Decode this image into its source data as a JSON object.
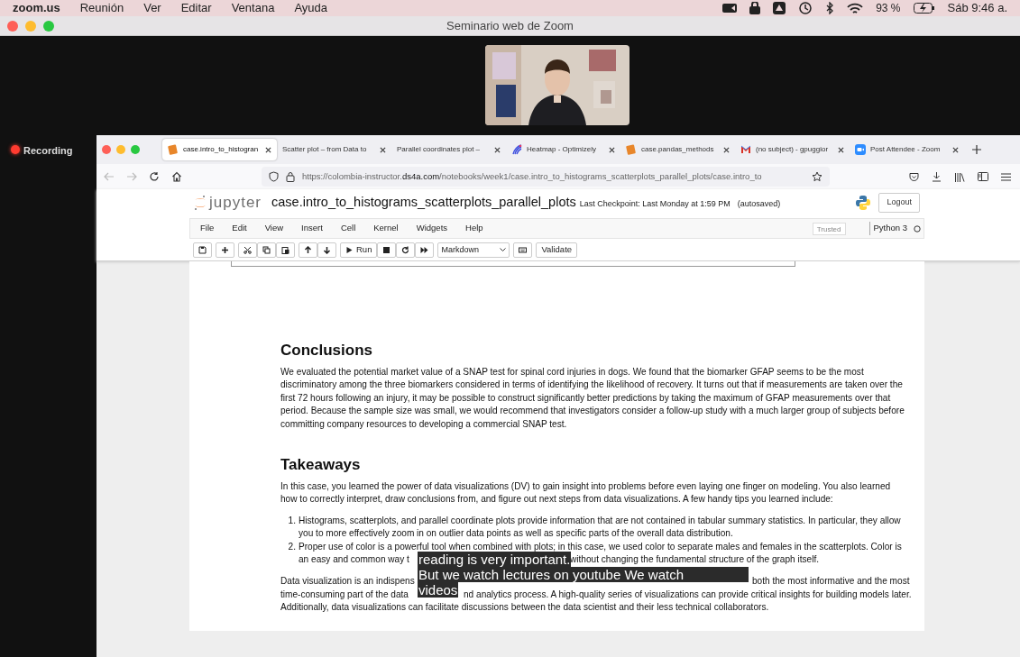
{
  "menubar": {
    "app": "zoom.us",
    "items": [
      "Reunión",
      "Ver",
      "Editar",
      "Ventana",
      "Ayuda"
    ],
    "battery": "93 %",
    "clock": "Sáb 9:46 a."
  },
  "window": {
    "title": "Seminario web de Zoom"
  },
  "recording": {
    "label": "Recording",
    "on": true
  },
  "browser": {
    "tabs": [
      {
        "title": "case.intro_to_histogran",
        "selected": true
      },
      {
        "title": "Scatter plot – from Data to",
        "selected": false
      },
      {
        "title": "Parallel coordinates plot – ",
        "selected": false
      },
      {
        "title": "Heatmap - Optimizely",
        "selected": false
      },
      {
        "title": "case.pandas_methods",
        "selected": false
      },
      {
        "title": "(no subject) - gpuggior",
        "selected": false
      },
      {
        "title": "Post Attendee - Zoom",
        "selected": false
      }
    ],
    "url": {
      "prefix": "https://colombia-instructor.",
      "domain": "ds4a.com",
      "path": "/notebooks/week1/case.intro_to_histograms_scatterplots_parallel_plots/case.intro_to"
    }
  },
  "jupyter": {
    "logo_text": "jupyter",
    "notebook_title": "case.intro_to_histograms_scatterplots_parallel_plots",
    "checkpoint": "Last Checkpoint: Last Monday at 1:59 PM",
    "save_status": "(autosaved)",
    "logout": "Logout",
    "menu": [
      "File",
      "Edit",
      "View",
      "Insert",
      "Cell",
      "Kernel",
      "Widgets",
      "Help"
    ],
    "trusted": "Trusted",
    "kernel": "Python 3",
    "toolbar": {
      "run": "Run",
      "cell_type": "Markdown",
      "validate": "Validate"
    }
  },
  "notebook": {
    "sections": [
      {
        "heading": "Conclusions",
        "blocks": [
          {
            "kind": "paragraph",
            "text": "We evaluated the potential market value of a SNAP test for spinal cord injuries in dogs. We found that the biomarker GFAP seems to be the most discriminatory among the three biomarkers considered in terms of identifying the likelihood of recovery. It turns out that if measurements are taken over the first 72 hours following an injury, it may be possible to construct significantly better predictions by taking the maximum of GFAP measurements over that period. Because the sample size was small, we would recommend that investigators consider a follow-up study with a much larger group of subjects before committing company resources to developing a commercial SNAP test."
          }
        ]
      },
      {
        "heading": "Takeaways",
        "blocks": [
          {
            "kind": "paragraph",
            "text": "In this case, you learned the power of data visualizations (DV) to gain insight into problems before even laying one finger on modeling. You also learned how to correctly interpret, draw conclusions from, and figure out next steps from data visualizations. A few handy tips you learned include:"
          },
          {
            "kind": "list",
            "items": [
              {
                "number": "1.",
                "lines": [
                  [
                    "Histograms, scatterplots, and parallel coordinate plots provide information that are not contained in tabular summary statistics. In particular, they allow"
                  ],
                  [
                    "you to more effectively zoom in on outlier data points as well as specific parts of the overall data distribution."
                  ]
                ]
              },
              {
                "number": "2.",
                "lines": [
                  [
                    "Proper use of color is a powerful tool when combined with plots; in this case, we used color to separate males and females in the scatterplots. Color is"
                  ],
                  [
                    "an easy and common way t",
                    "without changing the fundamental structure of the graph itself."
                  ]
                ]
              }
            ]
          },
          {
            "kind": "lines",
            "lines": [
              [
                "Data visualization is an indispens",
                "both the most informative and the most"
              ],
              [
                "time-consuming part of the data",
                "nd analytics process. A high-quality series of visualizations can provide critical insights for building models later."
              ],
              [
                "Additionally, data visualizations can facilitate discussions between the data scientist and their less technical collaborators."
              ]
            ]
          }
        ]
      }
    ]
  },
  "captions": [
    "reading is very important.",
    "But we watch lectures on youtube We watch",
    "videos"
  ]
}
